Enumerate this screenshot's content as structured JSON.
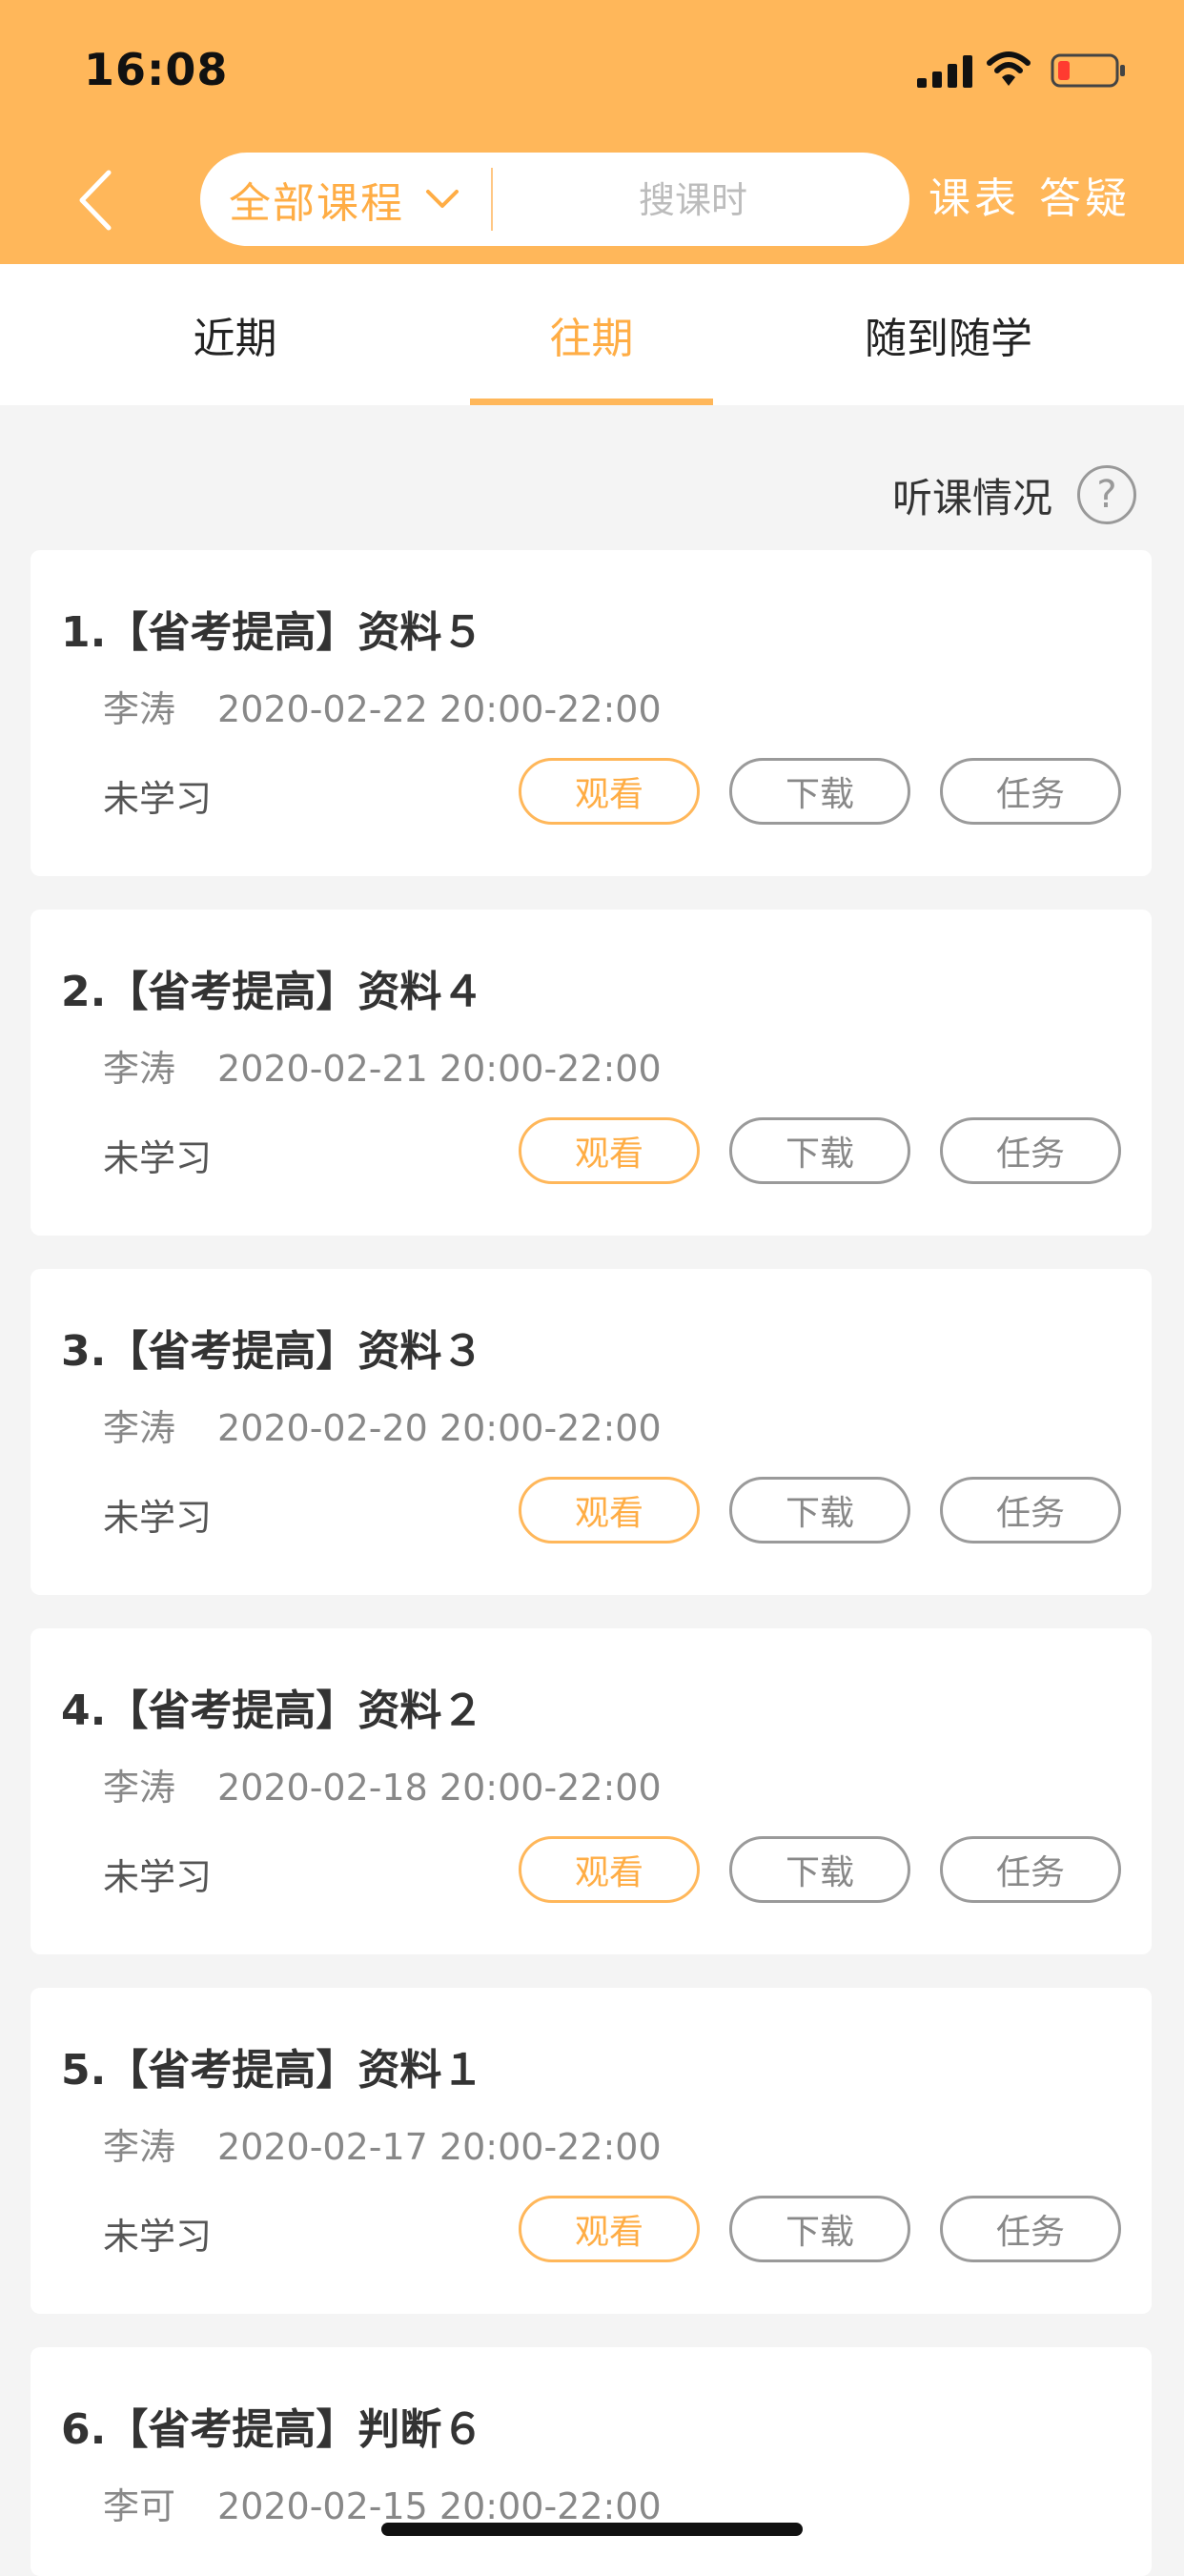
{
  "status_bar": {
    "time": "16:08"
  },
  "header": {
    "course_filter": "全部课程",
    "search_placeholder": "搜课时",
    "schedule_label": "课表",
    "qa_label": "答疑"
  },
  "tabs": [
    {
      "label": "近期"
    },
    {
      "label": "往期"
    },
    {
      "label": "随到随学"
    }
  ],
  "attendance": {
    "label": "听课情况",
    "help_glyph": "?"
  },
  "buttons": {
    "watch": "观看",
    "download": "下载",
    "task": "任务"
  },
  "lessons": [
    {
      "title": "1.【省考提高】资料５",
      "teacher": "李涛",
      "time": "2020-02-22 20:00-22:00",
      "status": "未学习"
    },
    {
      "title": "2.【省考提高】资料４",
      "teacher": "李涛",
      "time": "2020-02-21 20:00-22:00",
      "status": "未学习"
    },
    {
      "title": "3.【省考提高】资料３",
      "teacher": "李涛",
      "time": "2020-02-20 20:00-22:00",
      "status": "未学习"
    },
    {
      "title": "4.【省考提高】资料２",
      "teacher": "李涛",
      "time": "2020-02-18 20:00-22:00",
      "status": "未学习"
    },
    {
      "title": "5.【省考提高】资料１",
      "teacher": "李涛",
      "time": "2020-02-17 20:00-22:00",
      "status": "未学习"
    },
    {
      "title": "6.【省考提高】判断６",
      "teacher": "李可",
      "time": "2020-02-15 20:00-22:00",
      "status": ""
    }
  ],
  "colors": {
    "header_bg": "#ffb75a",
    "accent": "#ffad45",
    "page_bg": "#f4f4f4",
    "battery_low": "#ff3b30"
  },
  "icons": {
    "back": "chevron-left-icon",
    "filter": "chevron-down-icon",
    "signal": "signal-icon",
    "wifi": "wifi-icon",
    "battery": "battery-icon",
    "help": "question-circle-icon"
  }
}
